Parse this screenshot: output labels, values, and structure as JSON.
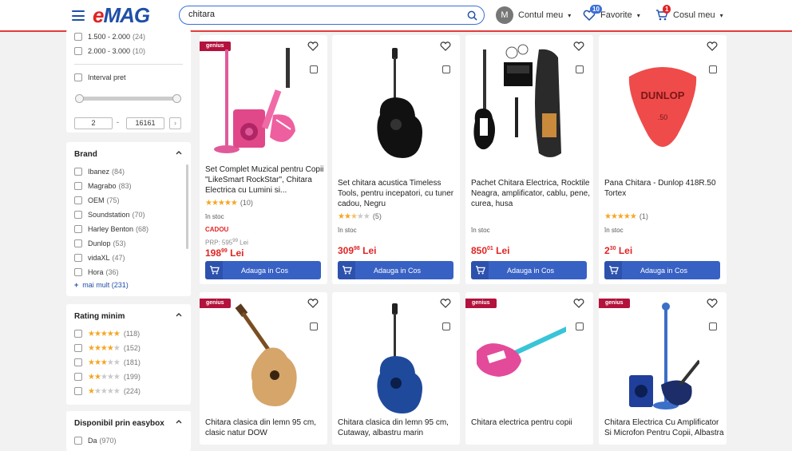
{
  "header": {
    "logo_e": "e",
    "logo_rest": "MAG",
    "search_value": "chitara",
    "avatar_letter": "M",
    "account_label": "Contul meu",
    "favorites_label": "Favorite",
    "favorites_count": "10",
    "cart_label": "Cosul meu",
    "cart_count": "1",
    "colors": {
      "brand_blue": "#1f4fa8",
      "brand_red": "#e02424",
      "button_blue": "#3861c4"
    }
  },
  "price_filter": {
    "ranges": [
      {
        "label": "1.500 - 2.000",
        "count": "(24)"
      },
      {
        "label": "2.000 - 3.000",
        "count": "(10)"
      }
    ],
    "interval_label": "Interval pret",
    "min_value": "2",
    "separator": "-",
    "max_value": "16161"
  },
  "brand_filter": {
    "title": "Brand",
    "items": [
      {
        "label": "Ibanez",
        "count": "(84)"
      },
      {
        "label": "Magrabo",
        "count": "(83)"
      },
      {
        "label": "OEM",
        "count": "(75)"
      },
      {
        "label": "Soundstation",
        "count": "(70)"
      },
      {
        "label": "Harley Benton",
        "count": "(68)"
      },
      {
        "label": "Dunlop",
        "count": "(53)"
      },
      {
        "label": "vidaXL",
        "count": "(47)"
      },
      {
        "label": "Hora",
        "count": "(36)"
      }
    ],
    "more_label": "mai mult",
    "more_count": "(231)"
  },
  "rating_filter": {
    "title": "Rating minim",
    "items": [
      {
        "stars": 5,
        "count": "(118)"
      },
      {
        "stars": 4,
        "count": "(152)"
      },
      {
        "stars": 3,
        "count": "(181)"
      },
      {
        "stars": 2,
        "count": "(199)"
      },
      {
        "stars": 1,
        "count": "(224)"
      }
    ]
  },
  "easybox_filter": {
    "title": "Disponibil prin easybox",
    "items": [
      {
        "label": "Da",
        "count": "(970)"
      }
    ]
  },
  "products_row1": [
    {
      "genius": "genius",
      "title": "Set Complet Muzical pentru Copii \"LikeSmart RockStar\", Chitara Electrica cu Lumini si...",
      "stars": 5,
      "rating_count": "(10)",
      "stock": "în stoc",
      "cadou": "CADOU",
      "prp": "PRP: 595",
      "prp_cents": "99",
      "prp_cur": "Lei",
      "price_int": "198",
      "price_cents": "99",
      "currency": "Lei",
      "button": "Adauga in Cos"
    },
    {
      "genius": "",
      "title": "Set chitara acustica Timeless Tools, pentru incepatori, cu tuner cadou, Negru",
      "stars": 2.5,
      "rating_count": "(5)",
      "stock": "în stoc",
      "price_int": "309",
      "price_cents": "98",
      "currency": "Lei",
      "button": "Adauga in Cos"
    },
    {
      "genius": "",
      "title": "Pachet Chitara Electrica, Rocktile Neagra, amplificator, cablu, pene, curea, husa",
      "stock": "în stoc",
      "price_int": "850",
      "price_cents": "01",
      "currency": "Lei",
      "button": "Adauga in Cos"
    },
    {
      "genius": "",
      "title": "Pana Chitara - Dunlop 418R.50 Tortex",
      "stars": 5,
      "rating_count": "(1)",
      "stock": "în stoc",
      "price_int": "2",
      "price_cents": "30",
      "currency": "Lei",
      "button": "Adauga in Cos",
      "logo_text": "DUNLOP",
      "logo_sub": ".50"
    }
  ],
  "products_row2": [
    {
      "genius": "genius",
      "title": "Chitara clasica din lemn 95 cm, clasic natur DOW"
    },
    {
      "genius": "",
      "title": "Chitara clasica din lemn 95 cm, Cutaway, albastru marin"
    },
    {
      "genius": "genius",
      "title": "Chitara electrica pentru copii"
    },
    {
      "genius": "genius",
      "title": "Chitara Electrica Cu Amplificator Si Microfon Pentru Copii, Albastra"
    }
  ]
}
